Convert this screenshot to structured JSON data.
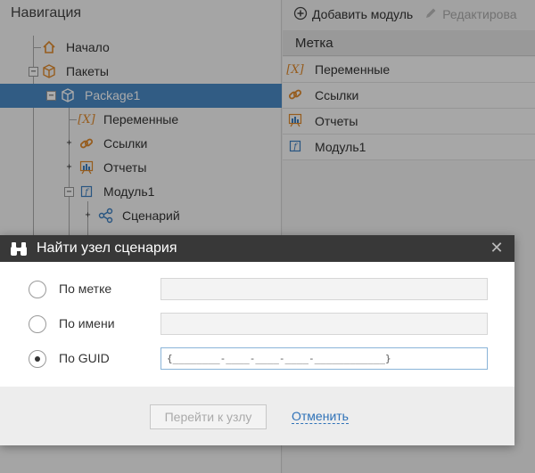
{
  "navigation": {
    "title": "Навигация",
    "tree": [
      {
        "label": "Начало",
        "icon": "home-icon"
      },
      {
        "label": "Пакеты",
        "icon": "package-icon"
      },
      {
        "label": "Package1",
        "icon": "package-icon",
        "selected": true
      },
      {
        "label": "Переменные",
        "icon": "variable-icon"
      },
      {
        "label": "Ссылки",
        "icon": "link-icon"
      },
      {
        "label": "Отчеты",
        "icon": "report-icon"
      },
      {
        "label": "Модуль1",
        "icon": "module-icon"
      },
      {
        "label": "Сценарий",
        "icon": "scenario-icon"
      }
    ]
  },
  "toolbar": {
    "add_module_label": "Добавить модуль",
    "edit_label": "Редактирова"
  },
  "list": {
    "column_header": "Метка",
    "items": [
      {
        "label": "Переменные",
        "icon": "variable-icon"
      },
      {
        "label": "Ссылки",
        "icon": "link-icon"
      },
      {
        "label": "Отчеты",
        "icon": "report-icon"
      },
      {
        "label": "Модуль1",
        "icon": "module-icon"
      }
    ]
  },
  "dialog": {
    "title": "Найти узел сценария",
    "close_glyph": "✕",
    "options": [
      {
        "label": "По метке",
        "value": "",
        "checked": false
      },
      {
        "label": "По имени",
        "value": "",
        "checked": false
      },
      {
        "label": "По GUID",
        "value": "{________-____-____-____-____________}",
        "checked": true
      }
    ],
    "go_button_label": "Перейти к узлу",
    "cancel_link_label": "Отменить"
  },
  "colors": {
    "selection": "#4a89c5",
    "titlebar": "#383838",
    "link": "#2f72b8",
    "icon_orange": "#e08a2c",
    "icon_blue": "#3d7fc1"
  }
}
